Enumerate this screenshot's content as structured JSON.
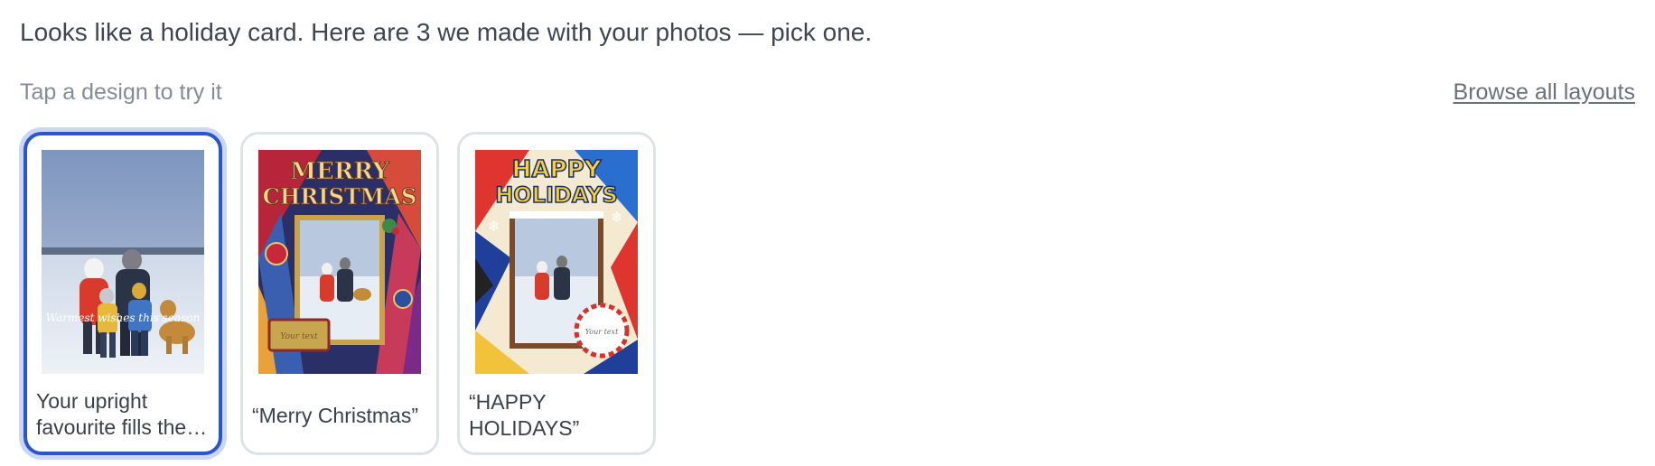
{
  "header": {
    "message": "Looks like a holiday card. Here are 3 we made with your photos — pick one.",
    "instruction": "Tap a design to try it",
    "browse_link": "Browse all layouts"
  },
  "designs": [
    {
      "label": "Your upright favourite fills the…",
      "overlay_text": "Warmest wishes this season",
      "selected": true
    },
    {
      "label": "“Merry Christmas”",
      "title_line1": "MERRY",
      "title_line2": "CHRISTMAS",
      "tag_text": "Your text",
      "selected": false
    },
    {
      "label": "“HAPPY HOLIDAYS”",
      "title_line1": "HAPPY",
      "title_line2": "HOLIDAYS",
      "tag_text": "Your text",
      "selected": false
    }
  ],
  "colors": {
    "selected_border": "#2a55cf",
    "selected_ring": "#c9d6f7",
    "card_border": "#dde3ea"
  }
}
